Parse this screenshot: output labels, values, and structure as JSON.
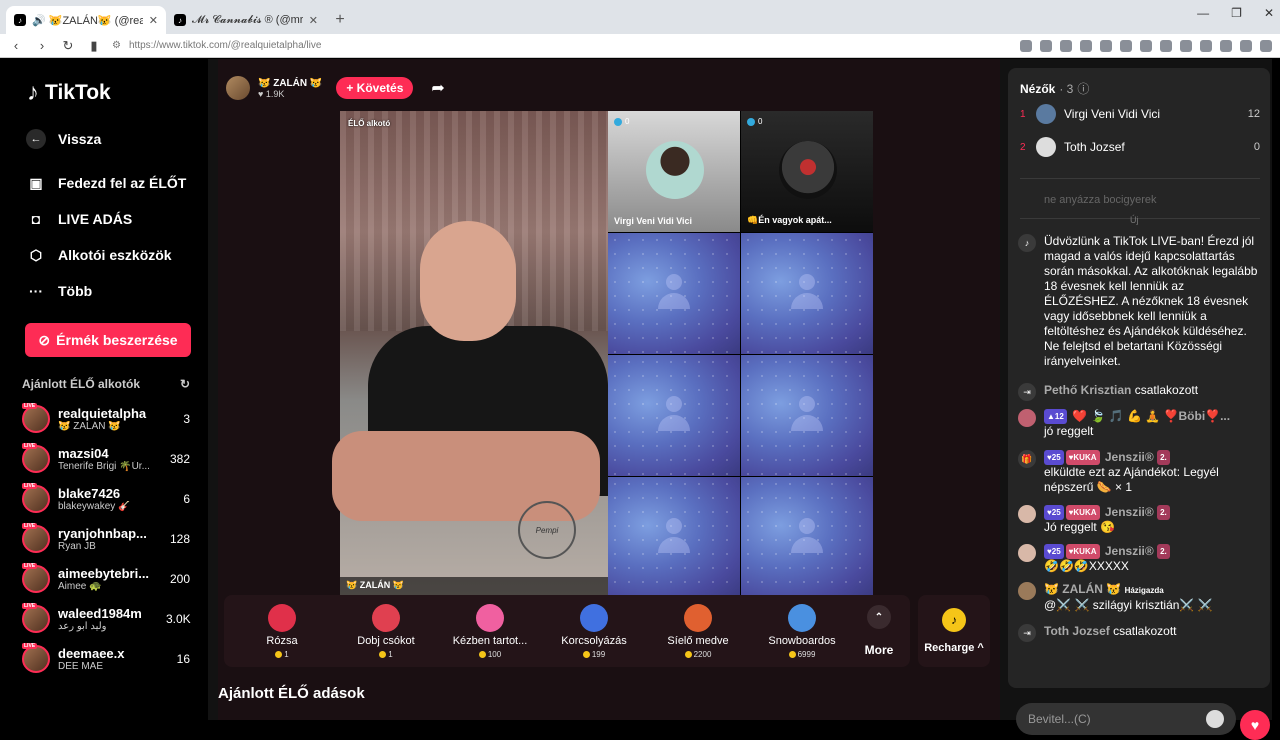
{
  "browser": {
    "tabs": [
      {
        "title": "🔊 😿ZALÁN😿 (@realquietalpha",
        "active": true
      },
      {
        "title": "𝓜𝓻 𝓒𝓪𝓷𝓷𝓪𝓫𝓲𝓼 ® (@mrcannabis_",
        "active": false
      }
    ],
    "url": "https://www.tiktok.com/@realquietalpha/live"
  },
  "sidebar": {
    "logo": "TikTok",
    "nav": [
      {
        "label": "Vissza",
        "icon": "back-arrow-icon"
      },
      {
        "label": "Fedezd fel az ÉLŐT",
        "icon": "live-explore-icon"
      },
      {
        "label": "LIVE ADÁS",
        "icon": "camera-icon"
      },
      {
        "label": "Alkotói eszközök",
        "icon": "creator-tools-icon"
      },
      {
        "label": "Több",
        "icon": "more-icon"
      }
    ],
    "coins_button": "Érmék beszerzése",
    "recommended_title": "Ajánlott ÉLŐ alkotók",
    "creators": [
      {
        "name": "realquietalpha",
        "sub": "😿 ZALÁN 😿",
        "count": "3"
      },
      {
        "name": "mazsi04",
        "sub": "Tenerife Brigi 🌴Úr...",
        "count": "382"
      },
      {
        "name": "blake7426",
        "sub": "blakeywakey 🎸",
        "count": "6"
      },
      {
        "name": "ryanjohnbap...",
        "sub": "Ryan JB",
        "count": "128"
      },
      {
        "name": "aimeebytebri...",
        "sub": "Aimee 🐢",
        "count": "200"
      },
      {
        "name": "waleed1984m",
        "sub": "وليد ابو رعد",
        "count": "3.0K"
      },
      {
        "name": "deemaee.x",
        "sub": "DEE MAE",
        "count": "16"
      }
    ]
  },
  "host": {
    "name": "😿 ZALÁN 😿",
    "likes": "1.9K",
    "follow": "+ Követés",
    "live_label": "ÉLŐ alkotó",
    "cam_name": "😿 ZALÁN 😿",
    "stamp": "Pempi"
  },
  "guests": [
    {
      "name": "Virgi Veni Vidi Vici",
      "views": "0"
    },
    {
      "name": "👊Én vagyok apát...",
      "views": "0"
    }
  ],
  "gifts": [
    {
      "label": "Rózsa",
      "price": "1",
      "color": "#e0304a"
    },
    {
      "label": "Dobj csókot",
      "price": "1",
      "color": "#e04050"
    },
    {
      "label": "Kézben tartot...",
      "price": "100",
      "color": "#f060a0"
    },
    {
      "label": "Korcsolyázás",
      "price": "199",
      "color": "#4070e0"
    },
    {
      "label": "Síelő medve",
      "price": "2200",
      "color": "#e06030"
    },
    {
      "label": "Snowboardos",
      "price": "6999",
      "color": "#4a90e0"
    }
  ],
  "more_label": "More",
  "recharge_label": "Recharge ^",
  "bottom_title": "Ajánlott ÉLŐ adások",
  "chat": {
    "viewers_title": "Nézők",
    "viewers_count": "· 3",
    "viewers": [
      {
        "rank": "1",
        "name": "Virgi Veni Vidi Vici",
        "score": "12"
      },
      {
        "rank": "2",
        "name": "Toth Jozsef",
        "score": "0"
      }
    ],
    "faded": "ne anyázza bocigyerek",
    "new_label": "Új",
    "welcome": "Üdvözlünk a TikTok LIVE-ban! Érezd jól magad a valós idejű kapcsolattartás során másokkal. Az alkotóknak legalább 18 évesnek kell lenniük az ÉLŐZÉSHEZ. A nézőknek 18 évesnek vagy idősebbnek kell lenniük a feltöltéshez és Ajándékok küldéséhez. Ne felejtsd el betartani Közösségi irányelveinket.",
    "messages": [
      {
        "user": "Pethő Krisztian",
        "text": "csatlakozott",
        "type": "join"
      },
      {
        "user": "❤️ 🍃 🎵 💪 🧘 ❣️Böbi❣️...",
        "level": "12",
        "text": "jó reggelt",
        "type": "msg"
      },
      {
        "user": "Jenszii®",
        "level": "25",
        "club": "KUKA",
        "fan": "2.",
        "text": "elküldte ezt az Ajándékot: Legyél népszerű 🌭 × 1",
        "type": "gift"
      },
      {
        "user": "Jenszii®",
        "level": "25",
        "club": "KUKA",
        "fan": "2.",
        "text": "Jó reggelt 😘",
        "type": "msg"
      },
      {
        "user": "Jenszii®",
        "level": "25",
        "club": "KUKA",
        "fan": "2.",
        "text": "🤣🤣🤣XXXXX",
        "type": "msg"
      },
      {
        "user": "😿 ZALÁN 😿",
        "role": "Házigazda",
        "text": "@⚔️ ⚔️ szilágyi krisztián⚔️ ⚔️",
        "type": "host"
      },
      {
        "user": "Toth Jozsef",
        "text": "csatlakozott",
        "type": "join"
      }
    ],
    "input_placeholder": "Bevitel...(C)"
  }
}
